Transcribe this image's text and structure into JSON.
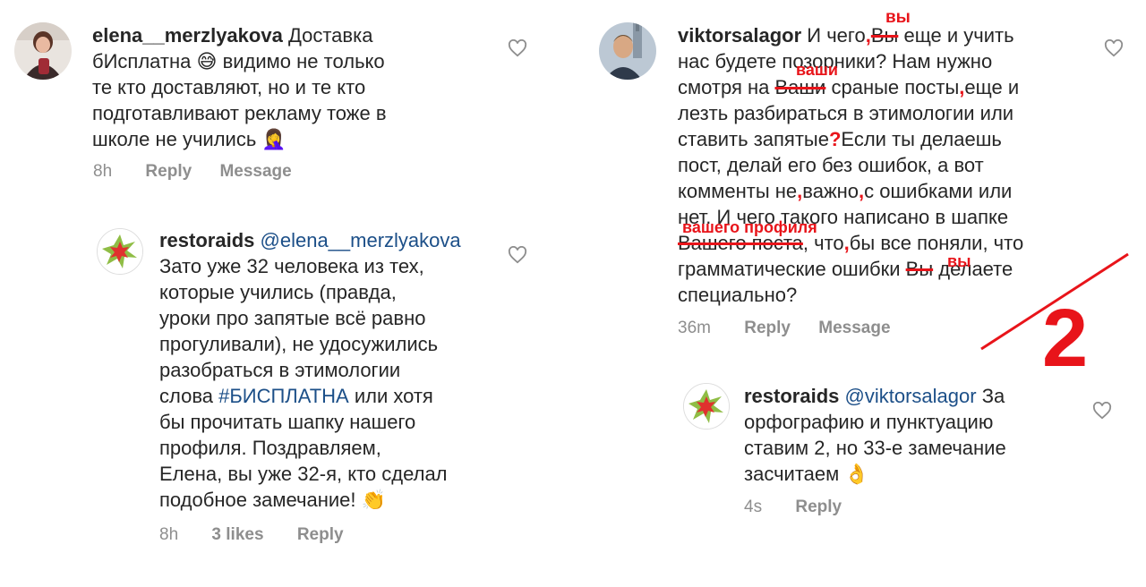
{
  "left": {
    "comment1": {
      "username": "elena__merzlyakova",
      "text_l1": "Доставка",
      "text_l2": "бИсплатна",
      "emoji1": "😅",
      "text_l2b": "видимо не только",
      "text_l3": "те кто доставляют, но и те кто",
      "text_l4": "подготавливают рекламу тоже в",
      "text_l5": "школе не учились",
      "emoji2": "🤦‍♀️",
      "time": "8h",
      "reply": "Reply",
      "message": "Message"
    },
    "reply1": {
      "username": "restoraids",
      "mention": "@elena__merzlyakova",
      "l1": "Зато уже 32 человека из тех,",
      "l2": "которые учились (правда,",
      "l3": "уроки про запятые всё равно",
      "l4": "прогуливали), не удосужились",
      "l5": "разобраться в этимологии",
      "l6a": "слова",
      "hashtag": "#БИСПЛАТНА",
      "l6b": "или хотя",
      "l7": "бы прочитать шапку нашего",
      "l8": "профиля. Поздравляем,",
      "l9": "Елена, вы уже 32-я, кто сделал",
      "l10": "подобное замечание!",
      "emoji": "👏",
      "time": "8h",
      "likes": "3 likes",
      "reply": "Reply"
    }
  },
  "right": {
    "comment2": {
      "username": "viktorsalagor",
      "l1a": "И чего",
      "l1_strike": "Вы",
      "l1b": "еще и учить",
      "l2": "нас будете позорники? Нам нужно",
      "l3a": "смотря на",
      "l3_strike": "Ваши",
      "l3b": "сраные посты",
      "l3c": "еще и",
      "l4": "лезть разбираться в этимологии или",
      "l5a": "ставить запятые",
      "l5b": "Если ты делаешь",
      "l6": "пост, делай его без ошибок, а вот",
      "l7a": "комменты не",
      "l7b": "важно",
      "l7c": "с ошибками или",
      "l8": "нет. И чего такого написано в шапке",
      "l9_strike": "Вашего поста",
      "l9a": ", что",
      "l9b": "бы все поняли, что",
      "l10a": "грамматические ошибки",
      "l10_strike": "Вы",
      "l10b": "делаете",
      "l11": "специально?",
      "time": "36m",
      "reply": "Reply",
      "message": "Message"
    },
    "corrections": {
      "vy1": "вы",
      "vashi": "ваши",
      "question": "?",
      "vashego_profilya": "вашего профиля",
      "vy2": "вы",
      "comma": ",",
      "grade": "2"
    },
    "reply2": {
      "username": "restoraids",
      "mention": "@viktorsalagor",
      "l1b": "За",
      "l2": "орфографию и пунктуацию",
      "l3": "ставим 2, но 33-е замечание",
      "l4": "засчитаем",
      "emoji": "👌",
      "time": "4s",
      "reply": "Reply"
    }
  },
  "colors": {
    "link": "#1c4f88",
    "muted": "#8e8e8e",
    "correction": "#e8141a"
  }
}
